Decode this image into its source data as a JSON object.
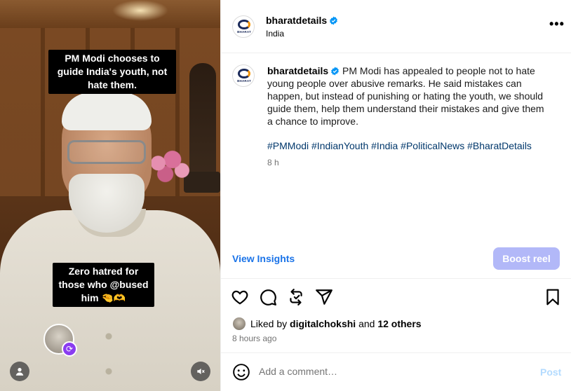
{
  "video": {
    "caption_top": "PM Modi chooses to guide India's youth, not hate them.",
    "caption_bottom": "Zero hatred for those who @bused him 🤏🫶",
    "icons": [
      "user-tag-icon",
      "collab-icon",
      "mute-icon"
    ]
  },
  "header": {
    "username": "bharatdetails",
    "location": "India",
    "logo_text": "BHARAT",
    "more_label": "•••"
  },
  "caption": {
    "username": "bharatdetails",
    "text": "PM Modi has appealed to people not to hate young people over abusive remarks. He said mistakes can happen, but instead of punishing or hating the youth, we should guide them, help them understand their mistakes and give them a chance to improve.",
    "hashtags": "#PMModi #IndianYouth #India #PoliticalNews #BharatDetails",
    "time": "8 h"
  },
  "insights": {
    "view_label": "View Insights",
    "boost_label": "Boost reel"
  },
  "actions": [
    "heart-icon",
    "comment-icon",
    "repost-icon",
    "send-icon",
    "bookmark-icon"
  ],
  "likes": {
    "prefix": "Liked by",
    "user": "digitalchokshi",
    "and": "and",
    "others": "12 others",
    "posted": "8 hours ago"
  },
  "comment": {
    "placeholder": "Add a comment…",
    "post_label": "Post"
  },
  "colors": {
    "verified": "#0095f6",
    "link": "#00376b",
    "insights": "#1a73e8",
    "boost_bg": "#b2b8f8",
    "post_disabled": "#b3dbff",
    "collab_badge": "#8a3cf0"
  }
}
